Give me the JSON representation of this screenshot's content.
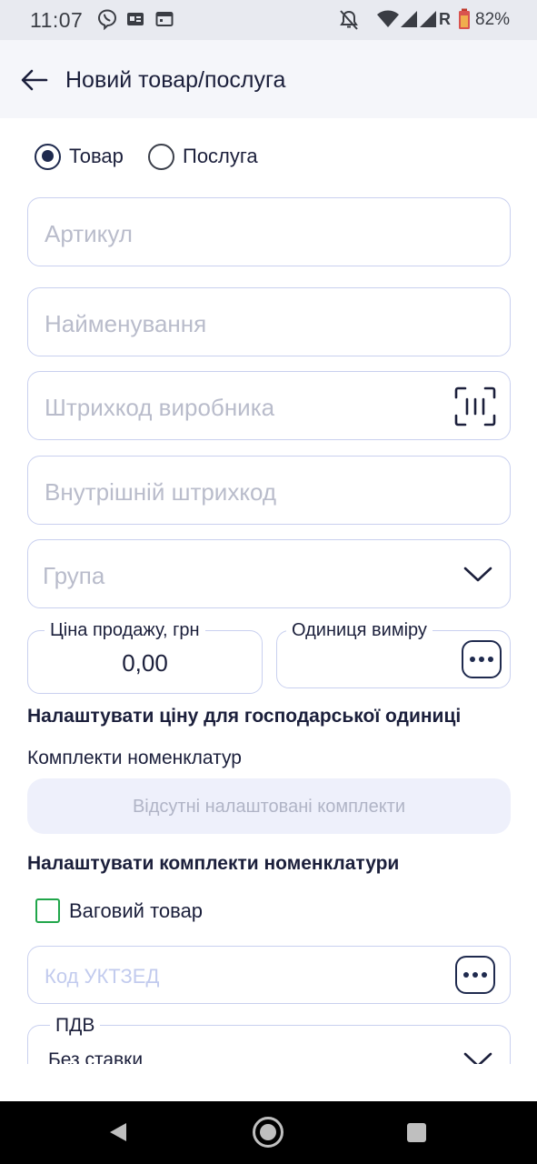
{
  "status_bar": {
    "time": "11:07",
    "battery_percent": "82%",
    "network_label": "R",
    "icons": [
      "viber-icon",
      "contact-card-icon",
      "calendar-icon",
      "mute-icon",
      "wifi-icon",
      "signal-icon",
      "signal-icon",
      "battery-icon"
    ]
  },
  "header": {
    "title": "Новий товар/послуга",
    "back_icon": "arrow-left-icon"
  },
  "type_selector": {
    "options": [
      {
        "label": "Товар",
        "selected": true
      },
      {
        "label": "Послуга",
        "selected": false
      }
    ]
  },
  "fields": {
    "article_placeholder": "Артикул",
    "name_placeholder": "Найменування",
    "manufacturer_barcode_placeholder": "Штрихкод виробника",
    "internal_barcode_placeholder": "Внутрішній штрихкод",
    "group_placeholder": "Група"
  },
  "price": {
    "label": "Ціна продажу, грн",
    "value": "0,00"
  },
  "unit": {
    "label": "Одиниця виміру"
  },
  "configure_price_link": "Налаштувати ціну для господарської одиниці",
  "kits": {
    "title": "Комплекти номенклатур",
    "empty_text": "Відсутні налаштовані комплекти",
    "configure_link": "Налаштувати комплекти номенклатури"
  },
  "weight_item": {
    "label": "Ваговий товар",
    "checked": false
  },
  "uktzed": {
    "placeholder": "Код УКТЗЕД"
  },
  "vat": {
    "label": "ПДВ",
    "value": "Без ставки"
  },
  "colors": {
    "primary": "#1f2a4e",
    "border": "#c9d0ef",
    "checkbox": "#20a64a",
    "kits_bg": "#eef0fb"
  }
}
